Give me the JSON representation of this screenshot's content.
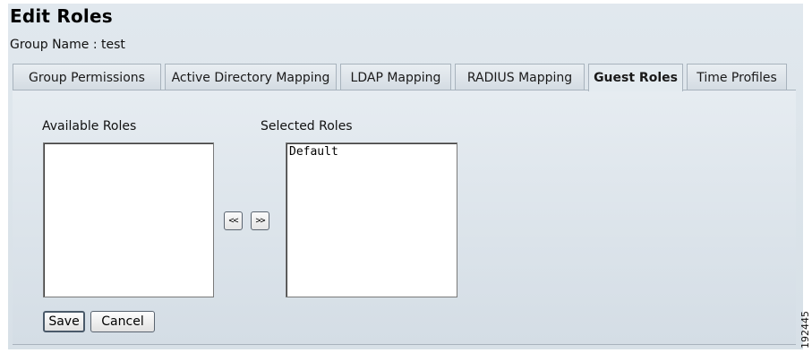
{
  "page": {
    "title": "Edit Roles",
    "group_label": "Group Name : test"
  },
  "tabs": [
    {
      "label": "Group Permissions",
      "active": false
    },
    {
      "label": "Active Directory Mapping",
      "active": false
    },
    {
      "label": "LDAP Mapping",
      "active": false
    },
    {
      "label": "RADIUS Mapping",
      "active": false
    },
    {
      "label": "Guest Roles",
      "active": true
    },
    {
      "label": "Time Profiles",
      "active": false
    }
  ],
  "roles": {
    "available_label": "Available Roles",
    "available_items": [],
    "selected_label": "Selected Roles",
    "selected_items": [
      "Default"
    ],
    "move_left_label": "<<",
    "move_right_label": ">>"
  },
  "actions": {
    "save_label": "Save",
    "cancel_label": "Cancel"
  },
  "figure_id": "192445"
}
